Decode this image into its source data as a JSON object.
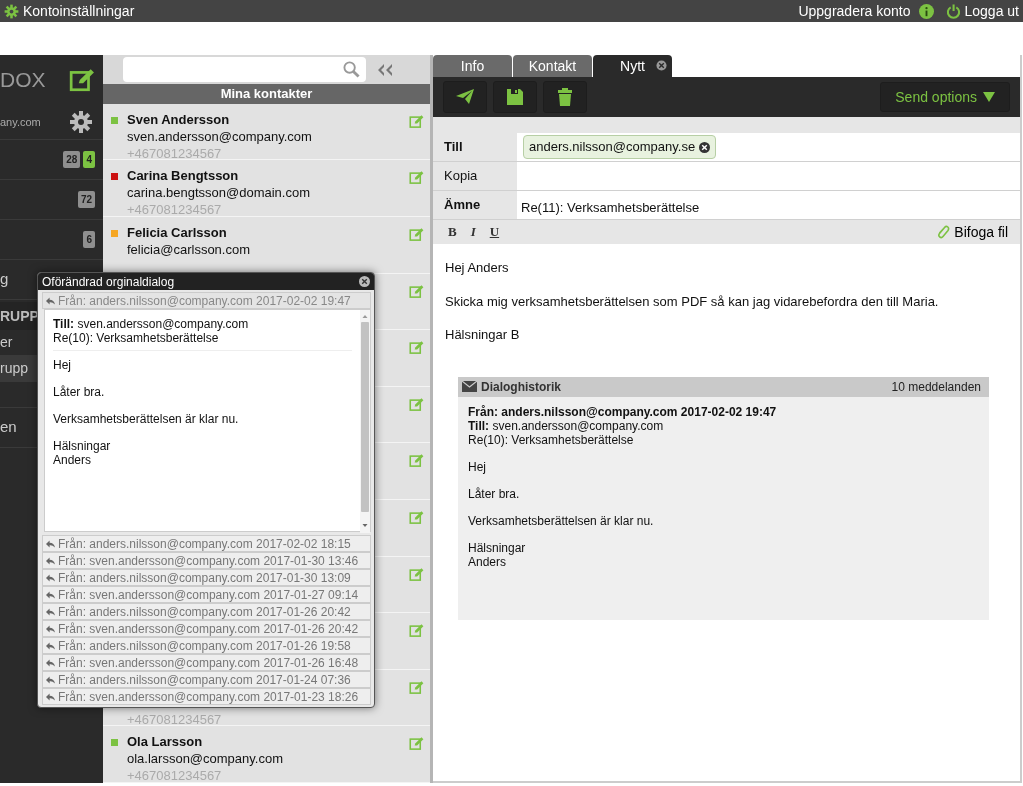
{
  "top_bar": {
    "title": "Kontoinställningar",
    "upgrade": "Uppgradera konto",
    "logout": "Logga ut"
  },
  "sidebar": {
    "brand": "DOX",
    "account": "any.com",
    "items": [
      {
        "kind": "folder",
        "badges": [
          {
            "text": "28",
            "color": "#8f8f8f"
          },
          {
            "text": "4",
            "color": "#7cc242"
          }
        ]
      },
      {
        "kind": "folder",
        "badges": [
          {
            "text": "72",
            "color": "#8f8f8f"
          }
        ]
      },
      {
        "kind": "folder",
        "badges": [
          {
            "text": "6",
            "color": "#8f8f8f"
          }
        ]
      },
      {
        "kind": "folder",
        "label": "g"
      },
      {
        "kind": "header",
        "label": "RUPP"
      },
      {
        "kind": "group",
        "label": "er",
        "selected": false
      },
      {
        "kind": "group",
        "label": "rupp",
        "selected": true
      },
      {
        "kind": "group",
        "selected": false
      },
      {
        "kind": "folder",
        "label": "en"
      }
    ]
  },
  "contacts": {
    "header": "Mina kontakter",
    "items": [
      {
        "kind": "contact",
        "name": "Sven Andersson",
        "email": "sven.andersson@company.com",
        "phone": "+467081234567",
        "color": "#7cc242"
      },
      {
        "kind": "contact",
        "name": "Carina Bengtsson",
        "email": "carina.bengtsson@domain.com",
        "phone": "+467081234567",
        "color": "#cc1111"
      },
      {
        "kind": "contact",
        "name": "Felicia Carlsson",
        "email": "felicia@carlsson.com",
        "color": "#f5a623"
      },
      {
        "kind": "covered"
      },
      {
        "kind": "covered"
      },
      {
        "kind": "covered"
      },
      {
        "kind": "covered"
      },
      {
        "kind": "covered"
      },
      {
        "kind": "covered"
      },
      {
        "kind": "covered"
      },
      {
        "kind": "covered",
        "phone": "+467081234567"
      },
      {
        "kind": "contact",
        "name": "Ola Larsson",
        "email": "ola.larsson@company.com",
        "phone": "+467081234567",
        "color": "#7cc242"
      }
    ]
  },
  "tabs": [
    {
      "label": "Info",
      "selected": false,
      "closable": false
    },
    {
      "label": "Kontakt",
      "selected": false,
      "closable": false
    },
    {
      "label": "Nytt",
      "selected": true,
      "closable": true
    }
  ],
  "toolbar": {
    "send_options": "Send options"
  },
  "compose": {
    "fields": [
      {
        "label": "Till",
        "required": true,
        "chips": [
          "anders.nilsson@company.se"
        ]
      },
      {
        "label": "Kopia",
        "required": false
      },
      {
        "label": "Ämne",
        "required": true,
        "value": "Re(11): Verksamhetsberättelse"
      }
    ],
    "format_buttons": [
      "B",
      "I",
      "U"
    ],
    "attach": "Bifoga fil",
    "body": [
      "Hej Anders",
      "Skicka mig verksamhetsberättelsen som PDF så kan jag vidarebefordra den till Maria.",
      "Hälsningar B"
    ],
    "history": {
      "title": "Dialoghistorik",
      "count": "10 meddelanden",
      "from": "Från: anders.nilsson@company.com 2017-02-02 19:47",
      "to": "**Till:** sven.andersson@company.com",
      "subject": "Re(10): Verksamhetsberättelse",
      "paragraphs": [
        [
          "Hej"
        ],
        [
          "Låter bra."
        ],
        [
          "Verksamhetsberättelsen är klar nu."
        ],
        [
          "Hälsningar",
          "Anders"
        ]
      ]
    }
  },
  "popup": {
    "title": "Oförändrad orginaldialog",
    "messages": [
      {
        "from": "Från: anders.nilsson@company.com 2017-02-02 19:47",
        "expanded": true,
        "to": "**Till:** sven.andersson@company.com",
        "subject": "Re(10): Verksamhetsberättelse",
        "paragraphs": [
          [
            "Hej"
          ],
          [
            "Låter bra."
          ],
          [
            "Verksamhetsberättelsen är klar nu."
          ],
          [
            "Hälsningar",
            "Anders"
          ]
        ]
      },
      {
        "from": "Från: anders.nilsson@company.com 2017-02-02 18:15",
        "expanded": false
      },
      {
        "from": "Från: sven.andersson@company.com 2017-01-30 13:46",
        "expanded": false
      },
      {
        "from": "Från: anders.nilsson@company.com 2017-01-30 13:09",
        "expanded": false
      },
      {
        "from": "Från: sven.andersson@company.com 2017-01-27 09:14",
        "expanded": false
      },
      {
        "from": "Från: anders.nilsson@company.com 2017-01-26 20:42",
        "expanded": false
      },
      {
        "from": "Från: sven.andersson@company.com 2017-01-26 20:42",
        "expanded": false
      },
      {
        "from": "Från: anders.nilsson@company.com 2017-01-26 19:58",
        "expanded": false
      },
      {
        "from": "Från: sven.andersson@company.com 2017-01-26 16:48",
        "expanded": false
      },
      {
        "from": "Från: anders.nilsson@company.com 2017-01-24 07:36",
        "expanded": false
      },
      {
        "from": "Från: sven.andersson@company.com 2017-01-23 18:26",
        "expanded": false
      }
    ]
  }
}
